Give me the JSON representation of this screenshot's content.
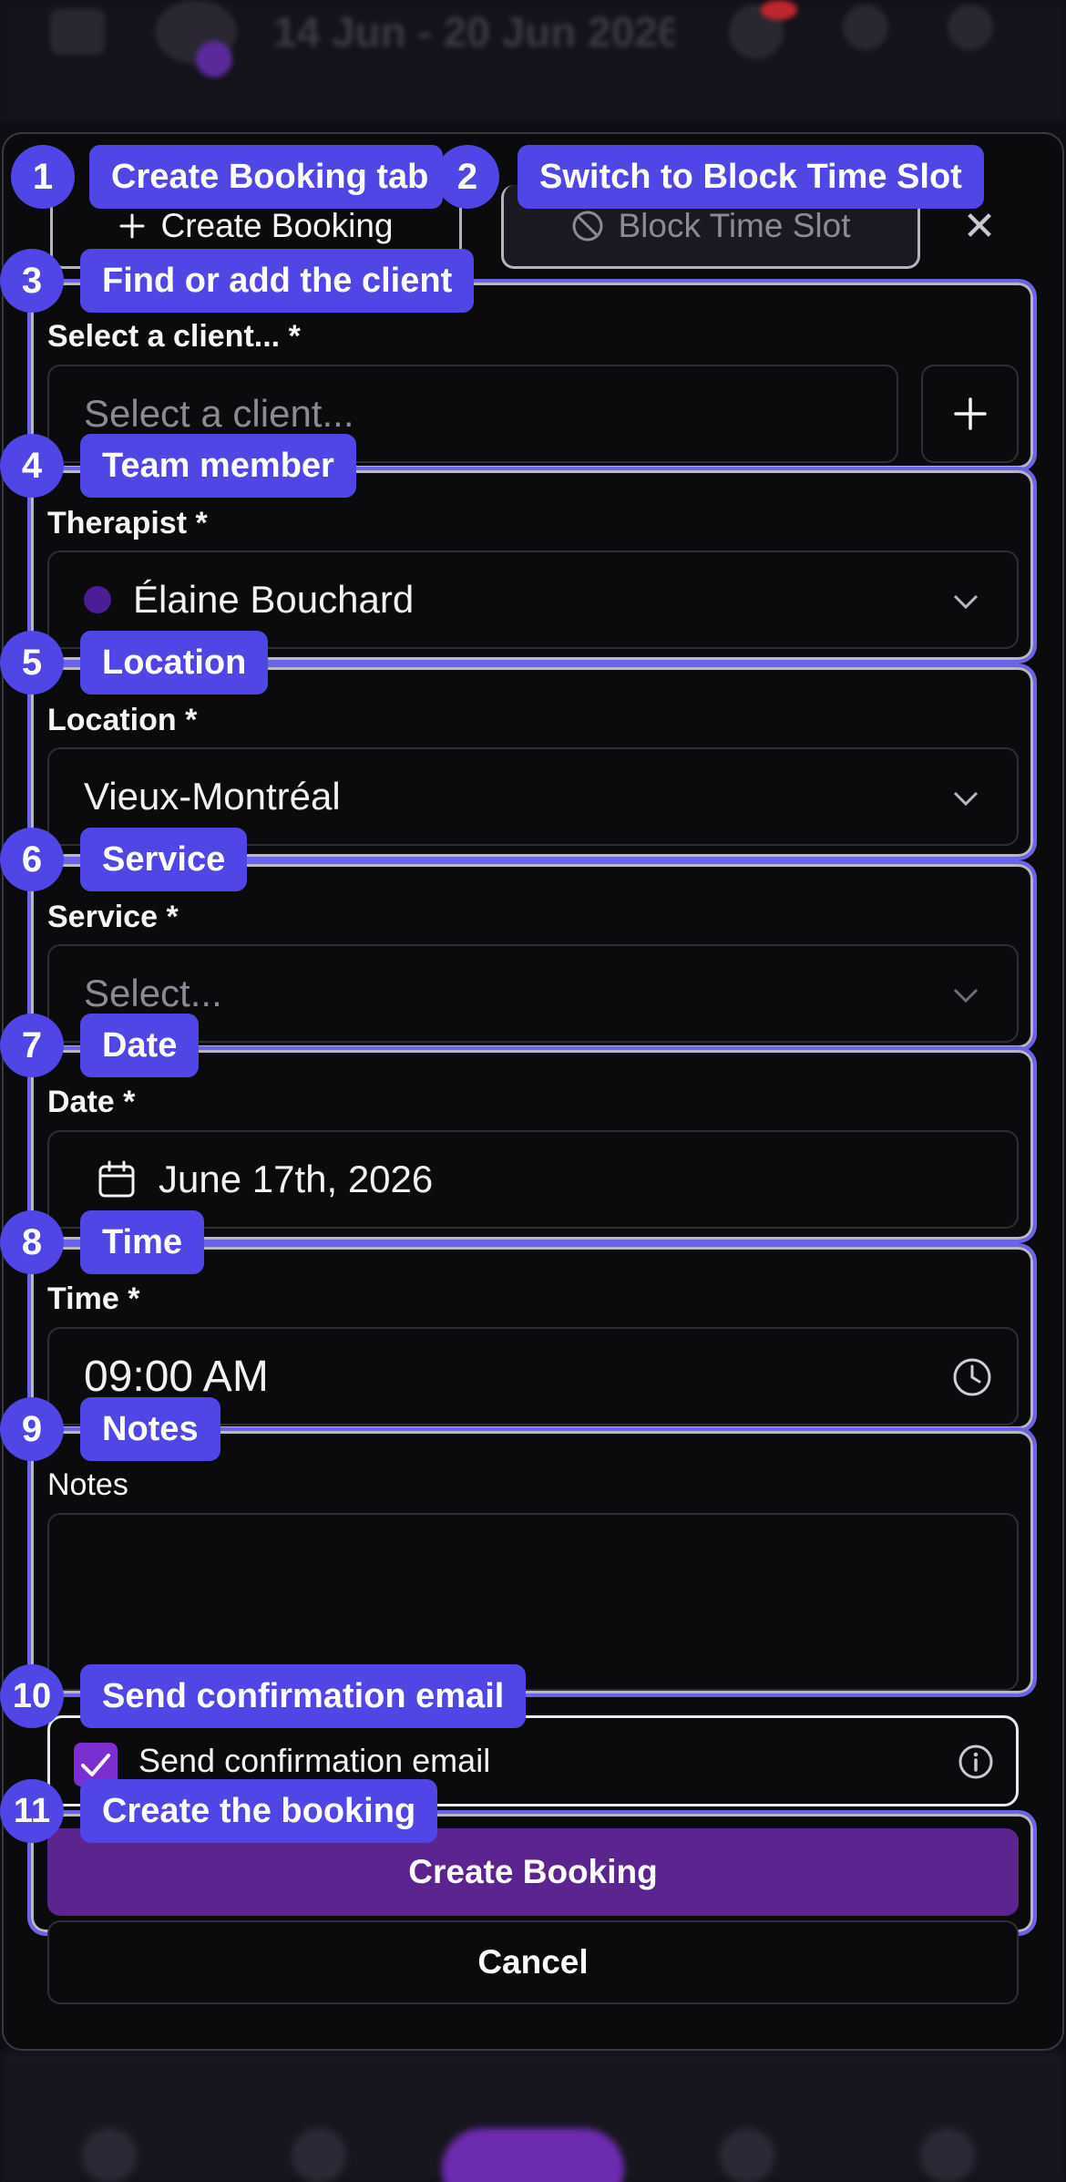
{
  "header": {
    "date_range": "14 Jun - 20 Jun 2026"
  },
  "tabs": {
    "create": {
      "label": "Create Booking",
      "icon": "plus-icon"
    },
    "block": {
      "label": "Block Time Slot",
      "icon": "ban-icon"
    }
  },
  "form": {
    "client": {
      "label": "Select a client... *",
      "placeholder": "Select a client..."
    },
    "therapist": {
      "label": "Therapist *",
      "value": "Élaine Bouchard",
      "color": "#4c1d95"
    },
    "location": {
      "label": "Location *",
      "value": "Vieux-Montréal"
    },
    "service": {
      "label": "Service *",
      "placeholder": "Select..."
    },
    "date": {
      "label": "Date *",
      "value": "June 17th, 2026"
    },
    "time": {
      "label": "Time *",
      "value": "09:00 AM"
    },
    "notes": {
      "label": "Notes",
      "value": ""
    },
    "confirmation": {
      "label": "Send confirmation email",
      "checked": true
    },
    "submit_label": "Create Booking",
    "cancel_label": "Cancel"
  },
  "annotations": [
    {
      "num": "1",
      "label": "Create Booking tab"
    },
    {
      "num": "2",
      "label": "Switch to Block Time Slot"
    },
    {
      "num": "3",
      "label": "Find or add the client"
    },
    {
      "num": "4",
      "label": "Team member"
    },
    {
      "num": "5",
      "label": "Location"
    },
    {
      "num": "6",
      "label": "Service"
    },
    {
      "num": "7",
      "label": "Date"
    },
    {
      "num": "8",
      "label": "Time"
    },
    {
      "num": "9",
      "label": "Notes"
    },
    {
      "num": "10",
      "label": "Send confirmation email"
    },
    {
      "num": "11",
      "label": "Create the booking"
    }
  ],
  "colors": {
    "accent": "#4f46e5",
    "primary_button": "#5b248f",
    "checkbox": "#7c2fd0",
    "background": "#0b0a0d"
  }
}
